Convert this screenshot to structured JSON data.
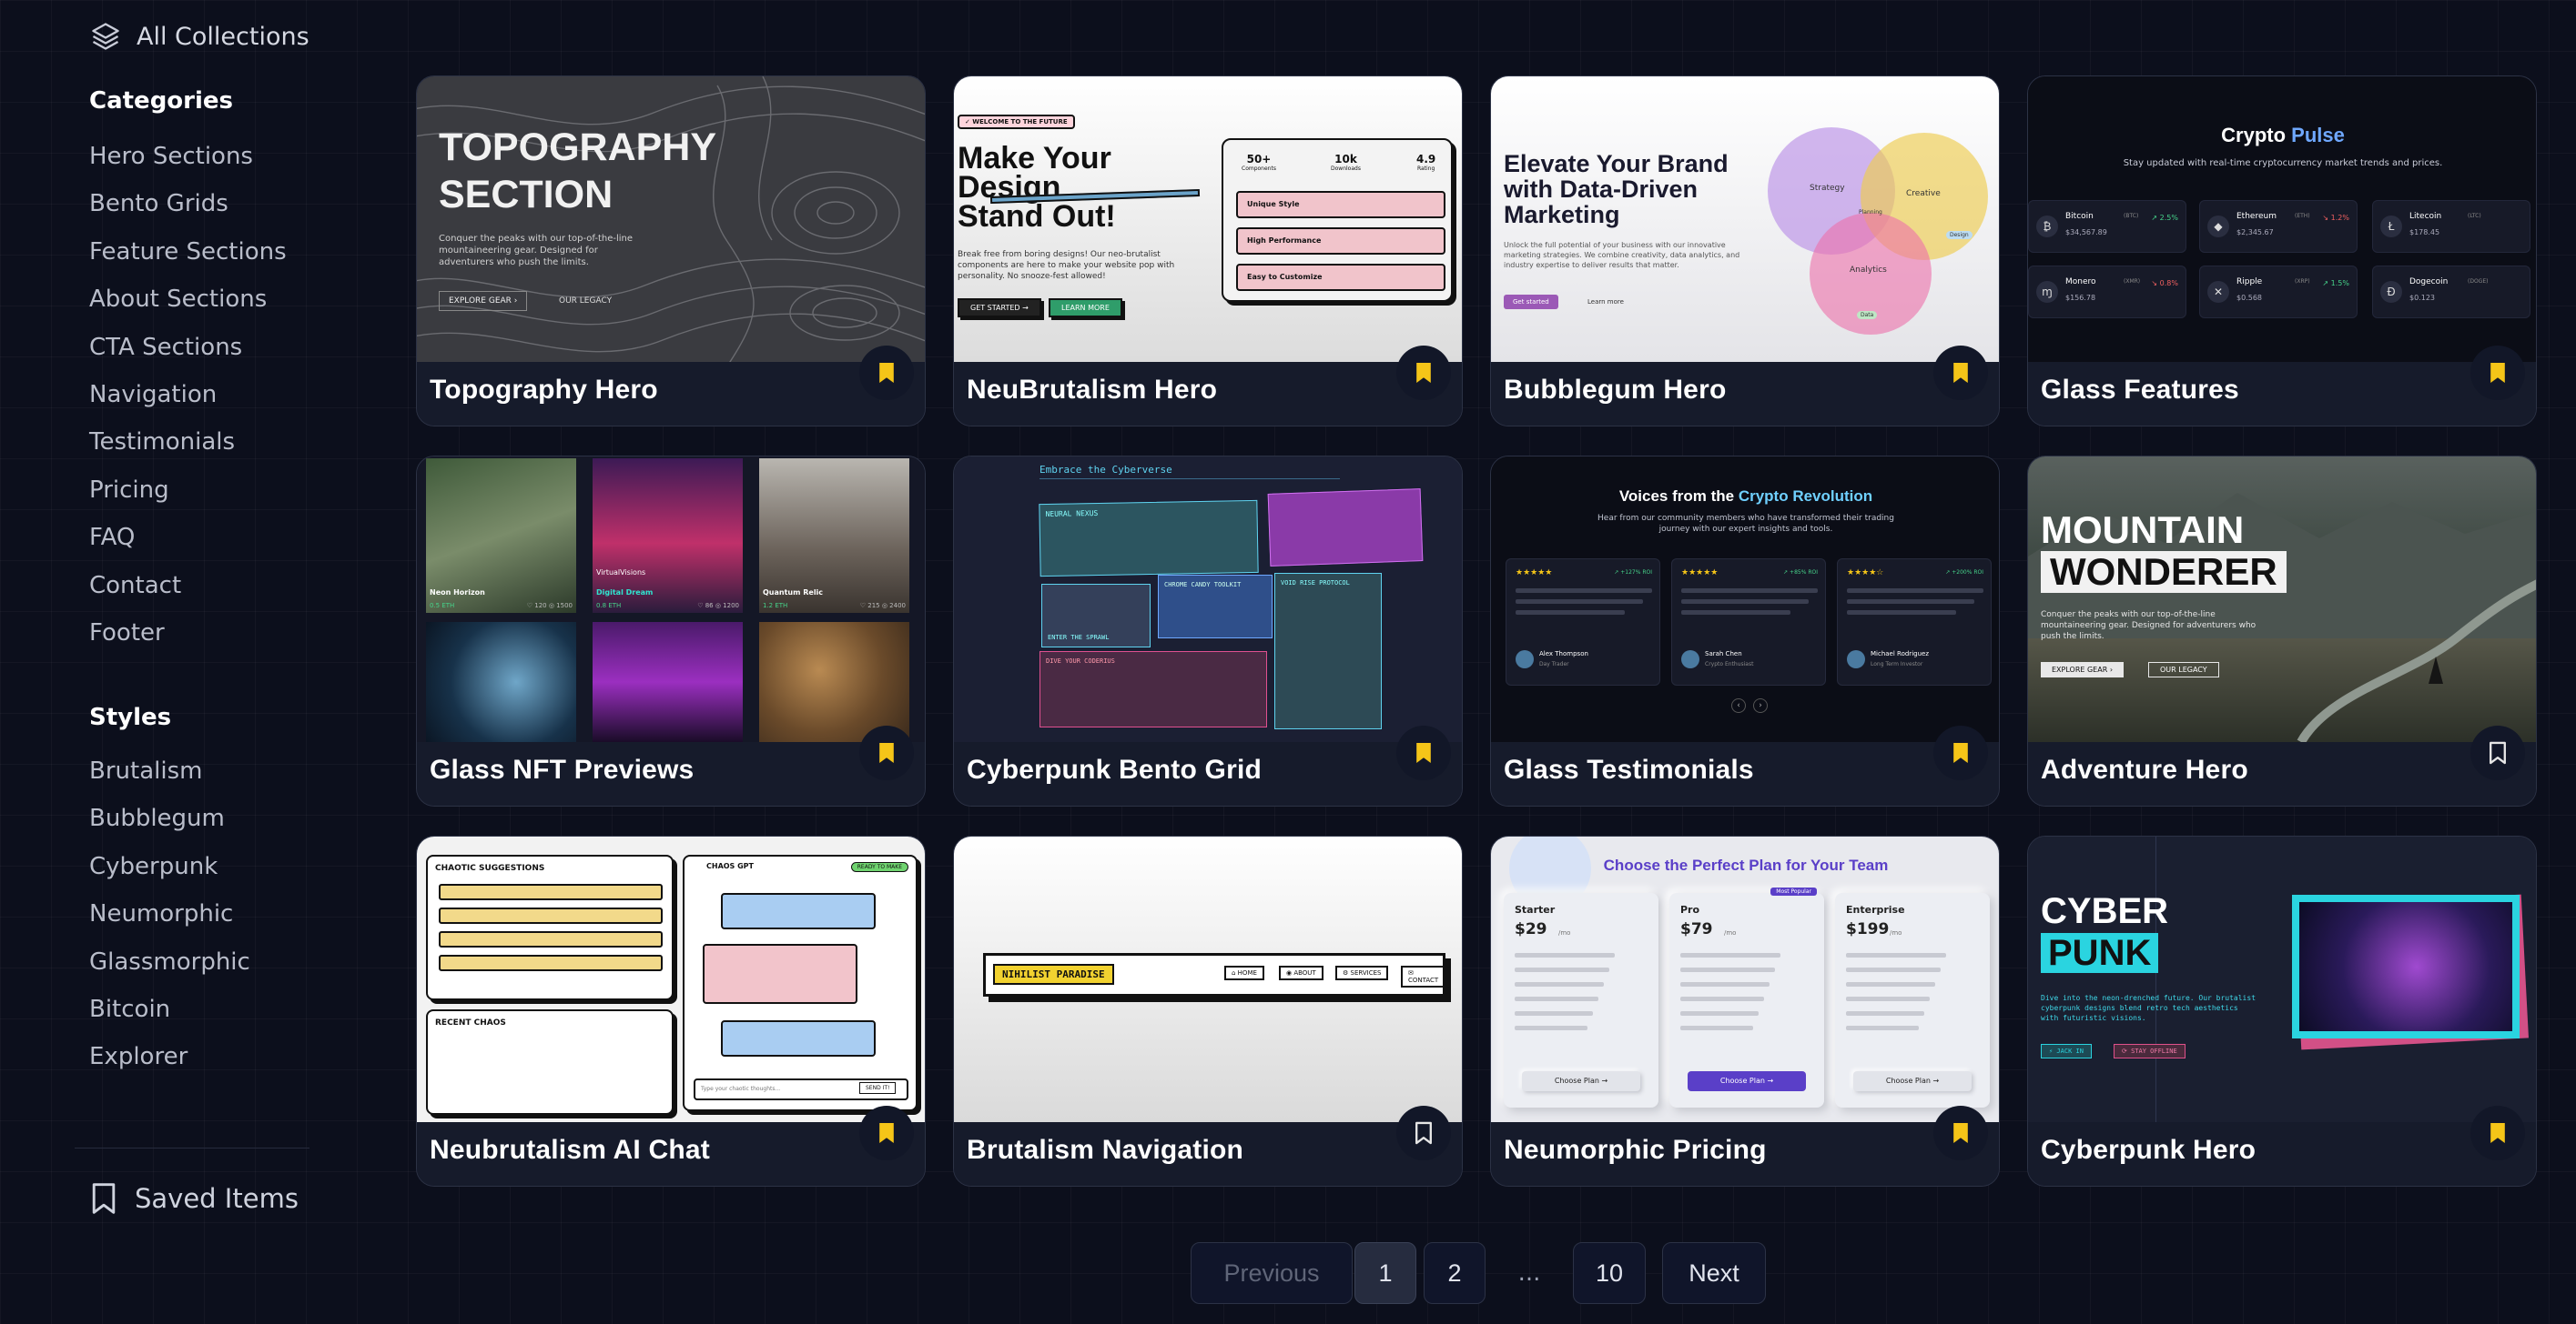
{
  "sidebar": {
    "all_collections": "All Collections",
    "categories_heading": "Categories",
    "categories": [
      "Hero Sections",
      "Bento Grids",
      "Feature Sections",
      "About Sections",
      "CTA Sections",
      "Navigation",
      "Testimonials",
      "Pricing",
      "FAQ",
      "Contact",
      "Footer"
    ],
    "styles_heading": "Styles",
    "styles": [
      "Brutalism",
      "Bubblegum",
      "Cyberpunk",
      "Neumorphic",
      "Glassmorphic",
      "Bitcoin",
      "Explorer"
    ],
    "saved_items": "Saved Items"
  },
  "cards": [
    {
      "title": "Topography Hero",
      "saved": true
    },
    {
      "title": "NeuBrutalism Hero",
      "saved": true
    },
    {
      "title": "Bubblegum Hero",
      "saved": true
    },
    {
      "title": "Glass Features",
      "saved": true
    },
    {
      "title": "Glass NFT Previews",
      "saved": true
    },
    {
      "title": "Cyberpunk Bento Grid",
      "saved": true
    },
    {
      "title": "Glass Testimonials",
      "saved": true
    },
    {
      "title": "Adventure Hero",
      "saved": false
    },
    {
      "title": "Neubrutalism AI Chat",
      "saved": true
    },
    {
      "title": "Brutalism Navigation",
      "saved": false
    },
    {
      "title": "Neumorphic Pricing",
      "saved": true
    },
    {
      "title": "Cyberpunk Hero",
      "saved": true
    }
  ],
  "previews": {
    "topography": {
      "heading1": "TOPOGRAPHY",
      "heading2": "SECTION",
      "body": "Conquer the peaks with our top-of-the-line mountaineering gear. Designed for adventurers who push the limits.",
      "btn1": "EXPLORE GEAR ›",
      "btn2": "OUR LEGACY"
    },
    "neubrutal": {
      "badge": "✓ WELCOME TO THE FUTURE",
      "h1": "Make Your",
      "h2": "Design",
      "h3": "Stand Out!",
      "body": "Break free from boring designs! Our neo-brutalist components are here to make your website pop with personality. No snooze-fest allowed!",
      "btn1": "GET STARTED →",
      "btn2": "LEARN MORE",
      "stat1v": "50+",
      "stat1l": "Components",
      "stat2v": "10k",
      "stat2l": "Downloads",
      "stat3v": "4.9",
      "stat3l": "Rating",
      "f1": "Unique Style",
      "f2": "High Performance",
      "f3": "Easy to Customize"
    },
    "bubblegum": {
      "h1": "Elevate Your Brand",
      "h2": "with Data-Driven",
      "h3": "Marketing",
      "body": "Unlock the full potential of your business with our innovative marketing strategies. We combine creativity, data analytics, and industry expertise to deliver results that matter.",
      "btn1": "Get started",
      "btn2": "Learn more",
      "c1": "Strategy",
      "c2": "Creative",
      "c3": "Analytics",
      "c4": "Planning",
      "c5": "Design",
      "c6": "Data"
    },
    "glassfeat": {
      "title_a": "Crypto ",
      "title_b": "Pulse",
      "sub": "Stay updated with real-time cryptocurrency market trends and prices.",
      "coins": [
        {
          "name": "Bitcoin",
          "sym": "(BTC)",
          "price": "$34,567.89",
          "chg": "↗ 2.5%",
          "up": true
        },
        {
          "name": "Ethereum",
          "sym": "(ETH)",
          "price": "$2,345.67",
          "chg": "↘ 1.2%",
          "up": false
        },
        {
          "name": "Litecoin",
          "sym": "(LTC)",
          "price": "$178.45",
          "chg": "",
          "up": true
        },
        {
          "name": "Monero",
          "sym": "(XMR)",
          "price": "$156.78",
          "chg": "↘ 0.8%",
          "up": false
        },
        {
          "name": "Ripple",
          "sym": "(XRP)",
          "price": "$0.568",
          "chg": "↗ 1.5%",
          "up": true
        },
        {
          "name": "Dogecoin",
          "sym": "(DOGE)",
          "price": "$0.123",
          "chg": "",
          "up": true
        }
      ]
    },
    "nft": {
      "items": [
        {
          "name": "Neon Horizon",
          "price": "0.5 ETH",
          "meta": "♡ 120  ◎ 1500"
        },
        {
          "name": "Digital Dream",
          "price": "0.8 ETH",
          "meta": "♡ 86  ◎ 1200",
          "tag": "VirtualVisions"
        },
        {
          "name": "Quantum Relic",
          "price": "1.2 ETH",
          "meta": "♡ 215  ◎ 2400"
        }
      ]
    },
    "cyberbento": {
      "title": "Embrace the Cyberverse",
      "b1": "NEURAL NEXUS",
      "b2": "ENTER THE SPRAWL",
      "b3": "CHROME CANDY TOOLKIT",
      "b4": "VOID RISE PROTOCOL",
      "b5": "DIVE YOUR CODERIUS"
    },
    "glasstest": {
      "title_a": "Voices from the ",
      "title_b": "Crypto Revolution",
      "sub": "Hear from our community members who have transformed their trading journey with our expert insights and tools.",
      "people": [
        {
          "name": "Alex Thompson",
          "role": "Day Trader",
          "stars": "★★★★★",
          "gain": "↗ +127% ROI"
        },
        {
          "name": "Sarah Chen",
          "role": "Crypto Enthusiast",
          "stars": "★★★★★",
          "gain": "↗ +85% ROI"
        },
        {
          "name": "Michael Rodriguez",
          "role": "Long Term Investor",
          "stars": "★★★★☆",
          "gain": "↗ +200% ROI"
        }
      ]
    },
    "adventure": {
      "h1": "MOUNTAIN",
      "h2": "WONDERER",
      "body": "Conquer the peaks with our top-of-the-line mountaineering gear. Designed for adventurers who push the limits.",
      "btn1": "EXPLORE GEAR ›",
      "btn2": "OUR LEGACY"
    },
    "aichat": {
      "panel1": "CHAOTIC SUGGESTIONS",
      "panel2": "RECENT CHAOS",
      "bot": "CHAOS GPT",
      "status": "READY TO MAKE",
      "input": "Type your chaotic thoughts...",
      "send": "SEND IT!"
    },
    "brutnav": {
      "logo": "NIHILIST PARADISE",
      "links": [
        "⌂ HOME",
        "◉ ABOUT",
        "⚙ SERVICES",
        "✉ CONTACT"
      ]
    },
    "neupricing": {
      "title": "Choose the Perfect Plan for Your Team",
      "plans": [
        {
          "name": "Starter",
          "price": "$29",
          "per": "/mo",
          "btn": "Choose Plan →"
        },
        {
          "name": "Pro",
          "price": "$79",
          "per": "/mo",
          "btn": "Choose Plan →",
          "badge": "Most Popular"
        },
        {
          "name": "Enterprise",
          "price": "$199",
          "per": "/mo",
          "btn": "Choose Plan →"
        }
      ]
    },
    "cyberhero": {
      "h1": "CYBER",
      "h2": "PUNK",
      "body": "Dive into the neon-drenched future. Our brutalist cyberpunk designs blend retro tech aesthetics with futuristic visions.",
      "btn1": "⚡ JACK IN",
      "btn2": "⟳ STAY OFFLINE"
    }
  },
  "pagination": {
    "previous": "Previous",
    "pages": [
      "1",
      "2"
    ],
    "ellipsis": "...",
    "last": "10",
    "next": "Next",
    "current": "1"
  },
  "colors": {
    "accent_bookmark": "#f5c518",
    "bg": "#0c0f1c",
    "card": "#161b2b"
  }
}
